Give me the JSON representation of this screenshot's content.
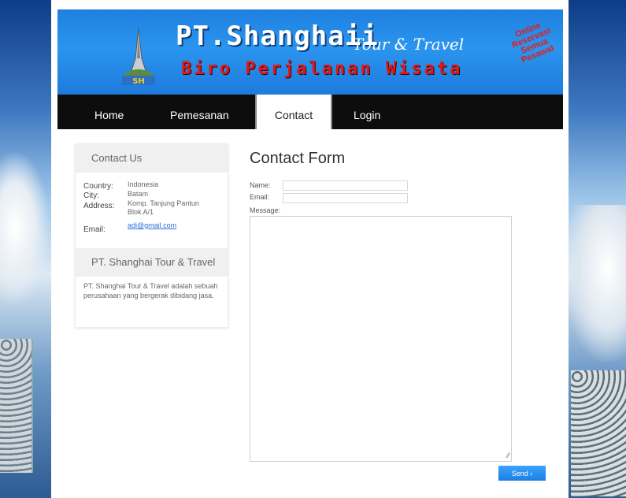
{
  "header": {
    "title": "PT.Shanghaii",
    "title_suffix": "Tour & Travel",
    "subtitle": "Biro Perjalanan Wisata",
    "logo_text": "SH",
    "stamp_lines": [
      "Online",
      "Reservasi",
      "Semua",
      "Pesawat"
    ]
  },
  "nav": {
    "items": [
      {
        "label": "Home"
      },
      {
        "label": "Pemesanan"
      },
      {
        "label": "Contact",
        "active": true
      },
      {
        "label": "Login"
      }
    ]
  },
  "sidebar": {
    "contact_heading": "Contact Us",
    "country_label": "Country:",
    "country_value": "Indonesia",
    "city_label": "City:",
    "city_value": "Batam",
    "address_label": "Address:",
    "address_value_1": "Komp. Tanjung Pantun",
    "address_value_2": "Blok A/1",
    "email_label": "Email:",
    "email_value": "adi@gmail.com",
    "company_heading": "PT. Shanghai Tour & Travel",
    "company_desc": "PT. Shanghai Tour & Travel adalah sebuah perusahaan yang bergerak dibidang jasa."
  },
  "form": {
    "title": "Contact Form",
    "name_label": "Name:",
    "email_label": "Email:",
    "message_label": "Message:",
    "send_label": "Send ›"
  },
  "colors": {
    "header_blue": "#2a95ef",
    "nav_black": "#0d0d0d",
    "subtitle_red": "#e01818",
    "button_blue": "#1c7fe0"
  }
}
